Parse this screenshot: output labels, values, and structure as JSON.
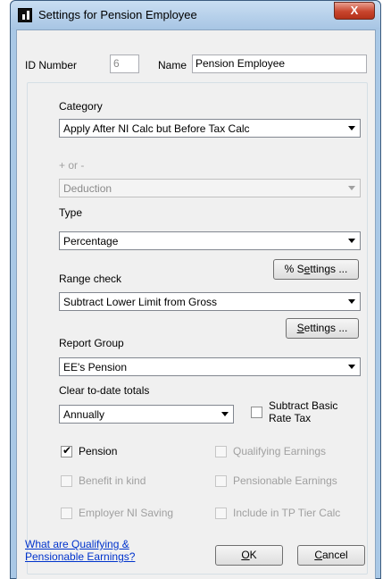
{
  "window": {
    "title": "Settings for Pension Employee",
    "close_glyph": "X"
  },
  "header": {
    "id_label": "ID Number",
    "id_value": "6",
    "name_label": "Name",
    "name_value": "Pension Employee"
  },
  "category": {
    "label": "Category",
    "value": "Apply After NI Calc but Before Tax Calc"
  },
  "sign": {
    "label": "+ or -",
    "value": "Deduction"
  },
  "type": {
    "label": "Type",
    "value": "Percentage"
  },
  "percent_settings_button": {
    "pre": "% S",
    "u": "e",
    "post": "ttings ..."
  },
  "range_check": {
    "label": "Range check",
    "value": "Subtract Lower Limit from Gross"
  },
  "settings_button": {
    "u": "S",
    "post": "ettings ..."
  },
  "report_group": {
    "label": "Report Group",
    "value": "EE's Pension"
  },
  "clear_totals": {
    "label": "Clear to-date totals",
    "value": "Annually"
  },
  "subtract_basic": {
    "line1": "Subtract Basic",
    "line2": "Rate Tax",
    "checked": false
  },
  "checkboxes": {
    "pension": {
      "label": "Pension",
      "checked": true,
      "enabled": true
    },
    "qualifying": {
      "label": "Qualifying Earnings",
      "checked": false,
      "enabled": false
    },
    "benefit": {
      "label": "Benefit in kind",
      "checked": false,
      "enabled": false
    },
    "pensionable": {
      "label": "Pensionable Earnings",
      "checked": false,
      "enabled": false
    },
    "employer_ni": {
      "label": "Employer NI Saving",
      "checked": false,
      "enabled": false
    },
    "tp_tier": {
      "label": "Include in TP Tier Calc",
      "checked": false,
      "enabled": false
    }
  },
  "help_link": {
    "line1": "What are Qualifying &",
    "line2": "Pensionable Earnings?"
  },
  "ok_button": {
    "u": "O",
    "post": "K"
  },
  "cancel_button": {
    "u": "C",
    "post": "ancel"
  },
  "check_glyph": "✔",
  "colors": {
    "titlebar": "#a9c8e6",
    "close": "#c8452d",
    "link": "#0033cc"
  }
}
